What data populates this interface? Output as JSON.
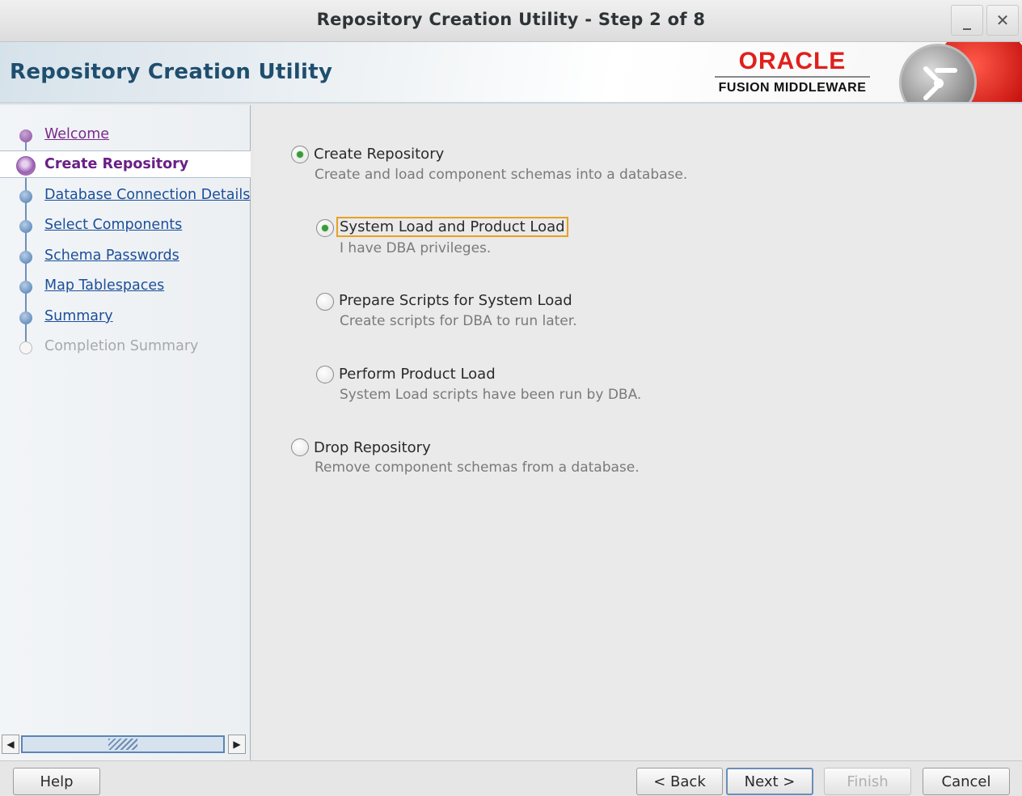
{
  "window": {
    "title": "Repository Creation Utility - Step 2 of 8",
    "minimize_glyph": "_",
    "close_glyph": "✕"
  },
  "banner": {
    "app_title": "Repository Creation Utility",
    "logo_brand": "ORACLE",
    "logo_product": "FUSION MIDDLEWARE"
  },
  "nav": {
    "items": [
      {
        "label": "Welcome",
        "state": "visited"
      },
      {
        "label": "Create Repository",
        "state": "current"
      },
      {
        "label": "Database Connection Details",
        "state": "link"
      },
      {
        "label": "Select Components",
        "state": "link"
      },
      {
        "label": "Schema Passwords",
        "state": "link"
      },
      {
        "label": "Map Tablespaces",
        "state": "link"
      },
      {
        "label": "Summary",
        "state": "link"
      },
      {
        "label": "Completion Summary",
        "state": "disabled"
      }
    ],
    "scroll_left": "◀",
    "scroll_right": "▶"
  },
  "options": {
    "create": {
      "label": "Create Repository",
      "desc": "Create and load component schemas into a database.",
      "selected": true
    },
    "system_product": {
      "label": "System Load and Product Load",
      "desc": "I have DBA privileges.",
      "selected": true
    },
    "prepare_scripts": {
      "label": "Prepare Scripts for System Load",
      "desc": "Create scripts for DBA to run later.",
      "selected": false
    },
    "product_load": {
      "label": "Perform Product Load",
      "desc": "System Load scripts have been run by DBA.",
      "selected": false
    },
    "drop": {
      "label": "Drop Repository",
      "desc": "Remove component schemas from a database.",
      "selected": false
    }
  },
  "buttons": {
    "help": "Help",
    "back": "< Back",
    "next": "Next >",
    "finish": "Finish",
    "cancel": "Cancel"
  }
}
